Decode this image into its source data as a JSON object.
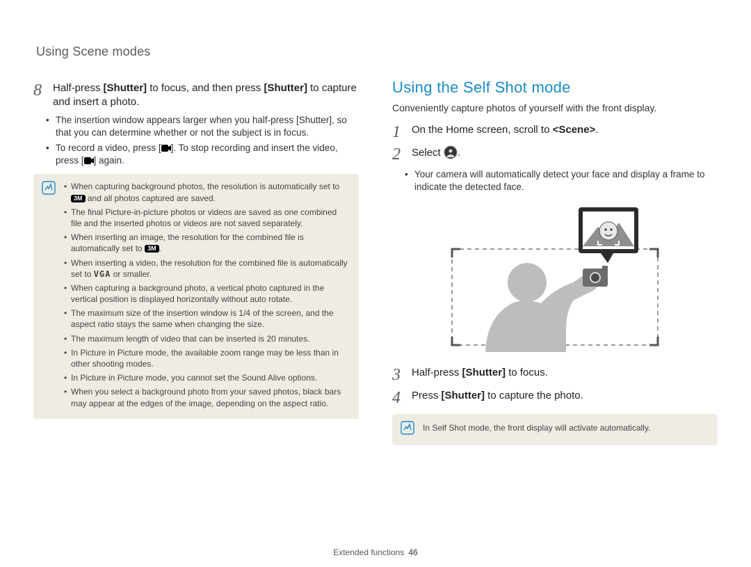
{
  "header": {
    "title": "Using Scene modes"
  },
  "left": {
    "step8": {
      "num": "8",
      "body_pre": "Half-press ",
      "shutter": "[Shutter]",
      "mid": " to focus, and then press ",
      "body_post": " to capture and insert a photo."
    },
    "subs": [
      {
        "pre": "The insertion window appears larger when you half-press ",
        "shutter": "[Shutter]",
        "post": ", so that you can determine whether or not the subject is in focus."
      },
      {
        "pre": "To record a video, press [",
        "post1": "]. To stop recording and insert the video, press [",
        "post2": "] again."
      }
    ],
    "notes": [
      {
        "pre": "When capturing background photos, the resolution is automatically set to ",
        "badge": "3M",
        "post": " and all photos captured are saved."
      },
      {
        "text": "The final Picture-in-picture photos or videos are saved as one combined file and the inserted photos or videos are not saved separately."
      },
      {
        "pre": "When inserting an image, the resolution for the combined file is automatically set to ",
        "badge": "3M",
        "post": "."
      },
      {
        "pre": "When inserting a video, the resolution for the combined file is automatically set to ",
        "vga": "VGA",
        "post": " or smaller."
      },
      {
        "text": "When capturing a background photo, a vertical photo captured in the vertical position is displayed horizontally without auto rotate."
      },
      {
        "text": "The maximum size of the insertion window is 1/4 of the screen, and the aspect ratio stays the same when changing the size."
      },
      {
        "text": "The maximum length of video that can be inserted is 20 minutes."
      },
      {
        "text": "In Picture in Picture mode, the available zoom range may be less than in other shooting modes."
      },
      {
        "text": "In Picture in Picture mode, you cannot set the Sound Alive options."
      },
      {
        "text": "When you select a background photo from your saved photos, black bars may appear at the edges of the image, depending on the aspect ratio."
      }
    ]
  },
  "right": {
    "heading": "Using the Self Shot mode",
    "lead": "Conveniently capture photos of yourself with the front display.",
    "steps": [
      {
        "num": "1",
        "pre": "On the Home screen, scroll to ",
        "tag": "<Scene>",
        "post": "."
      },
      {
        "num": "2",
        "pre": "Select ",
        "post": "."
      },
      {
        "num": "3",
        "pre": "Half-press ",
        "shutter": "[Shutter]",
        "post": " to focus."
      },
      {
        "num": "4",
        "pre": "Press ",
        "shutter": "[Shutter]",
        "post": " to capture the photo."
      }
    ],
    "sub2": "Your camera will automatically detect your face and display a frame to indicate the detected face.",
    "note": "In Self Shot mode, the front display will activate automatically."
  },
  "footer": {
    "section": "Extended functions",
    "page": "46"
  }
}
